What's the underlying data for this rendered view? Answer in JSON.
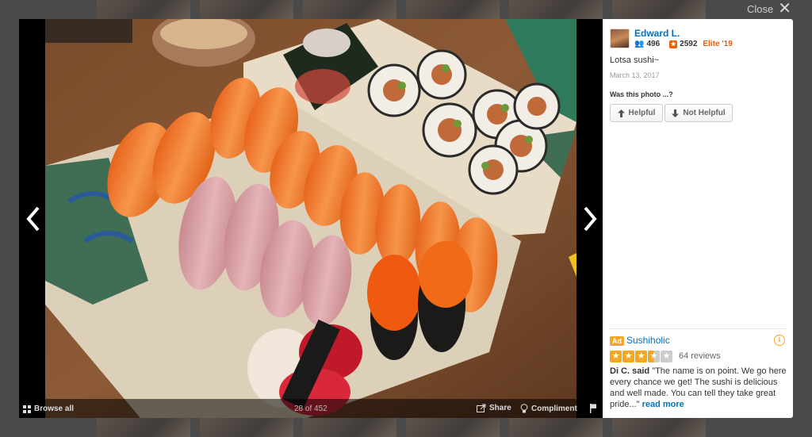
{
  "close": {
    "label": "Close"
  },
  "viewer": {
    "browse_all_label": "Browse all",
    "counter": "28 of 452",
    "share_label": "Share",
    "compliment_label": "Compliment"
  },
  "user": {
    "name": "Edward L.",
    "friends": "496",
    "reviews": "2592",
    "elite": "Elite '19"
  },
  "photo": {
    "caption": "Lotsa sushi~",
    "date": "March 13, 2017"
  },
  "helpful": {
    "prompt": "Was this photo ...?",
    "helpful_label": "Helpful",
    "not_helpful_label": "Not Helpful"
  },
  "ad": {
    "badge": "Ad",
    "business_name": "Sushiholic",
    "rating": 3.5,
    "review_count": "64 reviews",
    "reviewer": "Di C. said",
    "quote": "\"The name is on point. We go here every chance we get! The sushi is delicious and well made. You can tell they take great pride...\"",
    "read_more": "read more"
  },
  "colors": {
    "link": "#0073bb",
    "accent": "#f15c00",
    "star": "#f5a623"
  }
}
